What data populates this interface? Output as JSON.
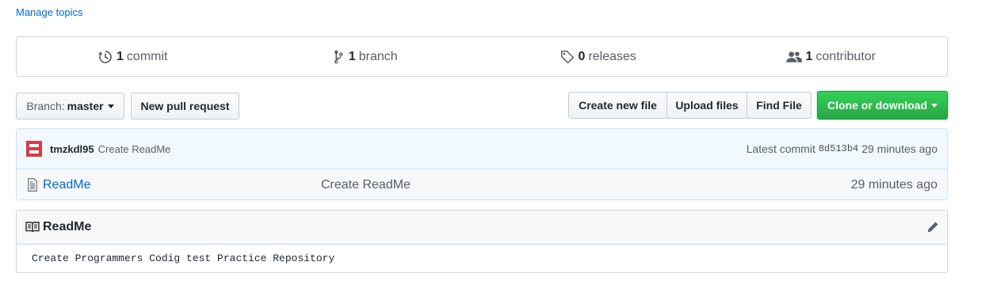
{
  "topics": {
    "manage_label": "Manage topics"
  },
  "summary": {
    "commits": {
      "count": "1",
      "label": "commit",
      "icon": "history-icon"
    },
    "branches": {
      "count": "1",
      "label": "branch",
      "icon": "git-branch-icon"
    },
    "releases": {
      "count": "0",
      "label": "releases",
      "icon": "tag-icon"
    },
    "contributors": {
      "count": "1",
      "label": "contributor",
      "icon": "people-icon"
    }
  },
  "toolbar": {
    "branch_prefix": "Branch:",
    "branch_name": "master",
    "new_pull_request": "New pull request",
    "create_new_file": "Create new file",
    "upload_files": "Upload files",
    "find_file": "Find File",
    "clone_or_download": "Clone or download"
  },
  "latest_commit": {
    "author": "tmzkdl95",
    "message": "Create ReadMe",
    "prefix": "Latest commit",
    "sha": "8d513b4",
    "age": "29 minutes ago"
  },
  "files": [
    {
      "name": "ReadMe",
      "message": "Create ReadMe",
      "age": "29 minutes ago",
      "icon": "file-text-icon"
    }
  ],
  "readme": {
    "title": "ReadMe",
    "content": "Create Programmers Codig test Practice Repository"
  },
  "colors": {
    "link": "#0366d6",
    "primary_button": "#28a745",
    "commit_bar": "#f1f8ff",
    "avatar": "#d73a49"
  }
}
